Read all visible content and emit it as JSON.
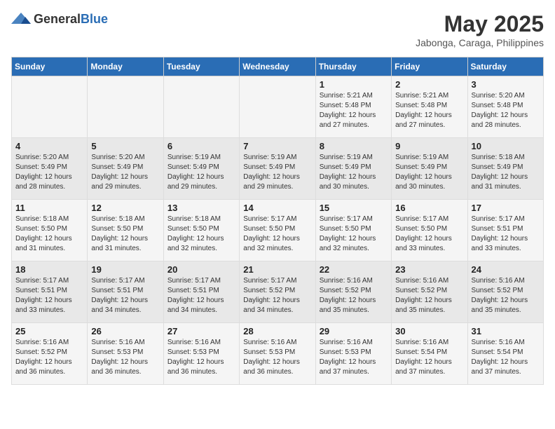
{
  "header": {
    "logo_general": "General",
    "logo_blue": "Blue",
    "month_year": "May 2025",
    "location": "Jabonga, Caraga, Philippines"
  },
  "days_of_week": [
    "Sunday",
    "Monday",
    "Tuesday",
    "Wednesday",
    "Thursday",
    "Friday",
    "Saturday"
  ],
  "weeks": [
    [
      {
        "day": "",
        "sunrise": "",
        "sunset": "",
        "daylight": ""
      },
      {
        "day": "",
        "sunrise": "",
        "sunset": "",
        "daylight": ""
      },
      {
        "day": "",
        "sunrise": "",
        "sunset": "",
        "daylight": ""
      },
      {
        "day": "",
        "sunrise": "",
        "sunset": "",
        "daylight": ""
      },
      {
        "day": "1",
        "sunrise": "Sunrise: 5:21 AM",
        "sunset": "Sunset: 5:48 PM",
        "daylight": "Daylight: 12 hours and 27 minutes."
      },
      {
        "day": "2",
        "sunrise": "Sunrise: 5:21 AM",
        "sunset": "Sunset: 5:48 PM",
        "daylight": "Daylight: 12 hours and 27 minutes."
      },
      {
        "day": "3",
        "sunrise": "Sunrise: 5:20 AM",
        "sunset": "Sunset: 5:48 PM",
        "daylight": "Daylight: 12 hours and 28 minutes."
      }
    ],
    [
      {
        "day": "4",
        "sunrise": "Sunrise: 5:20 AM",
        "sunset": "Sunset: 5:49 PM",
        "daylight": "Daylight: 12 hours and 28 minutes."
      },
      {
        "day": "5",
        "sunrise": "Sunrise: 5:20 AM",
        "sunset": "Sunset: 5:49 PM",
        "daylight": "Daylight: 12 hours and 29 minutes."
      },
      {
        "day": "6",
        "sunrise": "Sunrise: 5:19 AM",
        "sunset": "Sunset: 5:49 PM",
        "daylight": "Daylight: 12 hours and 29 minutes."
      },
      {
        "day": "7",
        "sunrise": "Sunrise: 5:19 AM",
        "sunset": "Sunset: 5:49 PM",
        "daylight": "Daylight: 12 hours and 29 minutes."
      },
      {
        "day": "8",
        "sunrise": "Sunrise: 5:19 AM",
        "sunset": "Sunset: 5:49 PM",
        "daylight": "Daylight: 12 hours and 30 minutes."
      },
      {
        "day": "9",
        "sunrise": "Sunrise: 5:19 AM",
        "sunset": "Sunset: 5:49 PM",
        "daylight": "Daylight: 12 hours and 30 minutes."
      },
      {
        "day": "10",
        "sunrise": "Sunrise: 5:18 AM",
        "sunset": "Sunset: 5:49 PM",
        "daylight": "Daylight: 12 hours and 31 minutes."
      }
    ],
    [
      {
        "day": "11",
        "sunrise": "Sunrise: 5:18 AM",
        "sunset": "Sunset: 5:50 PM",
        "daylight": "Daylight: 12 hours and 31 minutes."
      },
      {
        "day": "12",
        "sunrise": "Sunrise: 5:18 AM",
        "sunset": "Sunset: 5:50 PM",
        "daylight": "Daylight: 12 hours and 31 minutes."
      },
      {
        "day": "13",
        "sunrise": "Sunrise: 5:18 AM",
        "sunset": "Sunset: 5:50 PM",
        "daylight": "Daylight: 12 hours and 32 minutes."
      },
      {
        "day": "14",
        "sunrise": "Sunrise: 5:17 AM",
        "sunset": "Sunset: 5:50 PM",
        "daylight": "Daylight: 12 hours and 32 minutes."
      },
      {
        "day": "15",
        "sunrise": "Sunrise: 5:17 AM",
        "sunset": "Sunset: 5:50 PM",
        "daylight": "Daylight: 12 hours and 32 minutes."
      },
      {
        "day": "16",
        "sunrise": "Sunrise: 5:17 AM",
        "sunset": "Sunset: 5:50 PM",
        "daylight": "Daylight: 12 hours and 33 minutes."
      },
      {
        "day": "17",
        "sunrise": "Sunrise: 5:17 AM",
        "sunset": "Sunset: 5:51 PM",
        "daylight": "Daylight: 12 hours and 33 minutes."
      }
    ],
    [
      {
        "day": "18",
        "sunrise": "Sunrise: 5:17 AM",
        "sunset": "Sunset: 5:51 PM",
        "daylight": "Daylight: 12 hours and 33 minutes."
      },
      {
        "day": "19",
        "sunrise": "Sunrise: 5:17 AM",
        "sunset": "Sunset: 5:51 PM",
        "daylight": "Daylight: 12 hours and 34 minutes."
      },
      {
        "day": "20",
        "sunrise": "Sunrise: 5:17 AM",
        "sunset": "Sunset: 5:51 PM",
        "daylight": "Daylight: 12 hours and 34 minutes."
      },
      {
        "day": "21",
        "sunrise": "Sunrise: 5:17 AM",
        "sunset": "Sunset: 5:52 PM",
        "daylight": "Daylight: 12 hours and 34 minutes."
      },
      {
        "day": "22",
        "sunrise": "Sunrise: 5:16 AM",
        "sunset": "Sunset: 5:52 PM",
        "daylight": "Daylight: 12 hours and 35 minutes."
      },
      {
        "day": "23",
        "sunrise": "Sunrise: 5:16 AM",
        "sunset": "Sunset: 5:52 PM",
        "daylight": "Daylight: 12 hours and 35 minutes."
      },
      {
        "day": "24",
        "sunrise": "Sunrise: 5:16 AM",
        "sunset": "Sunset: 5:52 PM",
        "daylight": "Daylight: 12 hours and 35 minutes."
      }
    ],
    [
      {
        "day": "25",
        "sunrise": "Sunrise: 5:16 AM",
        "sunset": "Sunset: 5:52 PM",
        "daylight": "Daylight: 12 hours and 36 minutes."
      },
      {
        "day": "26",
        "sunrise": "Sunrise: 5:16 AM",
        "sunset": "Sunset: 5:53 PM",
        "daylight": "Daylight: 12 hours and 36 minutes."
      },
      {
        "day": "27",
        "sunrise": "Sunrise: 5:16 AM",
        "sunset": "Sunset: 5:53 PM",
        "daylight": "Daylight: 12 hours and 36 minutes."
      },
      {
        "day": "28",
        "sunrise": "Sunrise: 5:16 AM",
        "sunset": "Sunset: 5:53 PM",
        "daylight": "Daylight: 12 hours and 36 minutes."
      },
      {
        "day": "29",
        "sunrise": "Sunrise: 5:16 AM",
        "sunset": "Sunset: 5:53 PM",
        "daylight": "Daylight: 12 hours and 37 minutes."
      },
      {
        "day": "30",
        "sunrise": "Sunrise: 5:16 AM",
        "sunset": "Sunset: 5:54 PM",
        "daylight": "Daylight: 12 hours and 37 minutes."
      },
      {
        "day": "31",
        "sunrise": "Sunrise: 5:16 AM",
        "sunset": "Sunset: 5:54 PM",
        "daylight": "Daylight: 12 hours and 37 minutes."
      }
    ]
  ]
}
